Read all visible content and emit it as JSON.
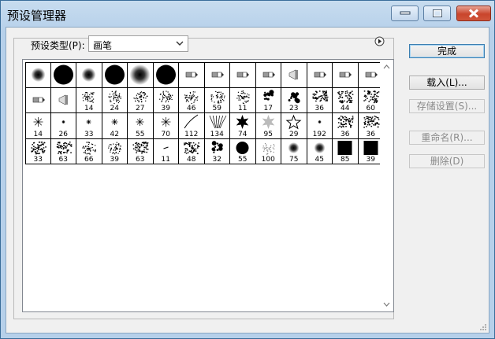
{
  "window": {
    "title": "预设管理器",
    "minimize_icon": "minimize-icon",
    "maximize_icon": "maximize-icon",
    "close_icon": "close-icon"
  },
  "preset_type": {
    "label": "预设类型(P):",
    "selected": "画笔"
  },
  "buttons": {
    "done": "完成",
    "load": "载入(L)...",
    "save": "存储设置(S)...",
    "rename": "重命名(R)...",
    "delete": "删除(D)"
  },
  "brushes": [
    {
      "kind": "soft-round",
      "label": ""
    },
    {
      "kind": "hard-round-large",
      "label": ""
    },
    {
      "kind": "soft-round",
      "label": ""
    },
    {
      "kind": "hard-round-large",
      "label": ""
    },
    {
      "kind": "soft-round-large",
      "label": ""
    },
    {
      "kind": "hard-round-large",
      "label": ""
    },
    {
      "kind": "tool-brush",
      "label": ""
    },
    {
      "kind": "tool-brush",
      "label": ""
    },
    {
      "kind": "tool-brush",
      "label": ""
    },
    {
      "kind": "tool-brush",
      "label": ""
    },
    {
      "kind": "tool-airbrush",
      "label": ""
    },
    {
      "kind": "tool-brush",
      "label": ""
    },
    {
      "kind": "tool-brush",
      "label": ""
    },
    {
      "kind": "tool-brush",
      "label": ""
    },
    {
      "kind": "tool-brush",
      "label": ""
    },
    {
      "kind": "tool-airbrush",
      "label": ""
    },
    {
      "kind": "scatter",
      "label": "14"
    },
    {
      "kind": "scatter",
      "label": "24"
    },
    {
      "kind": "scatter",
      "label": "27"
    },
    {
      "kind": "scatter",
      "label": "39"
    },
    {
      "kind": "scatter",
      "label": "46"
    },
    {
      "kind": "scatter",
      "label": "59"
    },
    {
      "kind": "scatter",
      "label": "11"
    },
    {
      "kind": "blob",
      "label": "17"
    },
    {
      "kind": "blob",
      "label": "23"
    },
    {
      "kind": "texture",
      "label": "36"
    },
    {
      "kind": "texture",
      "label": "44"
    },
    {
      "kind": "texture",
      "label": "60"
    },
    {
      "kind": "star",
      "label": "14"
    },
    {
      "kind": "star",
      "label": "26"
    },
    {
      "kind": "star",
      "label": "33"
    },
    {
      "kind": "star",
      "label": "42"
    },
    {
      "kind": "star",
      "label": "55"
    },
    {
      "kind": "star",
      "label": "70"
    },
    {
      "kind": "stroke",
      "label": "112"
    },
    {
      "kind": "grass",
      "label": "134"
    },
    {
      "kind": "leaf",
      "label": "74"
    },
    {
      "kind": "leaf-light",
      "label": "95"
    },
    {
      "kind": "star-outline",
      "label": "29"
    },
    {
      "kind": "star",
      "label": "192"
    },
    {
      "kind": "texture",
      "label": "36"
    },
    {
      "kind": "texture",
      "label": "36"
    },
    {
      "kind": "texture",
      "label": "33"
    },
    {
      "kind": "texture",
      "label": "63"
    },
    {
      "kind": "scatter",
      "label": "66"
    },
    {
      "kind": "scatter",
      "label": "39"
    },
    {
      "kind": "texture",
      "label": "63"
    },
    {
      "kind": "dash",
      "label": "11"
    },
    {
      "kind": "texture",
      "label": "48"
    },
    {
      "kind": "blob",
      "label": "32"
    },
    {
      "kind": "hard-round",
      "label": "55"
    },
    {
      "kind": "scatter-light",
      "label": "100"
    },
    {
      "kind": "soft-dot",
      "label": "75"
    },
    {
      "kind": "soft-dot",
      "label": "45"
    },
    {
      "kind": "square",
      "label": "85"
    },
    {
      "kind": "square",
      "label": "39"
    }
  ]
}
